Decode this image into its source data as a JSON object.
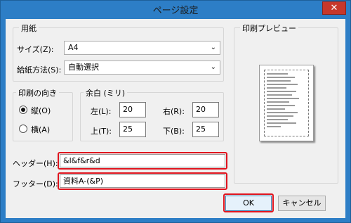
{
  "window": {
    "title": "ページ設定",
    "close_glyph": "✕"
  },
  "paper_group": {
    "legend": "用紙",
    "size_label": "サイズ(Z):",
    "size_value": "A4",
    "source_label": "給紙方法(S):",
    "source_value": "自動選択"
  },
  "orientation_group": {
    "legend": "印刷の向き",
    "portrait_label": "縦(O)",
    "landscape_label": "横(A)",
    "selected": "portrait"
  },
  "margins_group": {
    "legend": "余白 (ミリ)",
    "left_label": "左(L):",
    "left_value": "20",
    "right_label": "右(R):",
    "right_value": "20",
    "top_label": "上(T):",
    "top_value": "25",
    "bottom_label": "下(B):",
    "bottom_value": "25"
  },
  "preview_group": {
    "legend": "印刷プレビュー"
  },
  "header": {
    "label": "ヘッダー(H):",
    "value": "&l&f&r&d"
  },
  "footer": {
    "label": "フッター(D):",
    "value": "資料A-(&P)"
  },
  "buttons": {
    "ok": "OK",
    "cancel": "キャンセル"
  },
  "colors": {
    "titlebar": "#2d7ec6",
    "highlight": "#e0141e",
    "close": "#c7372b"
  }
}
